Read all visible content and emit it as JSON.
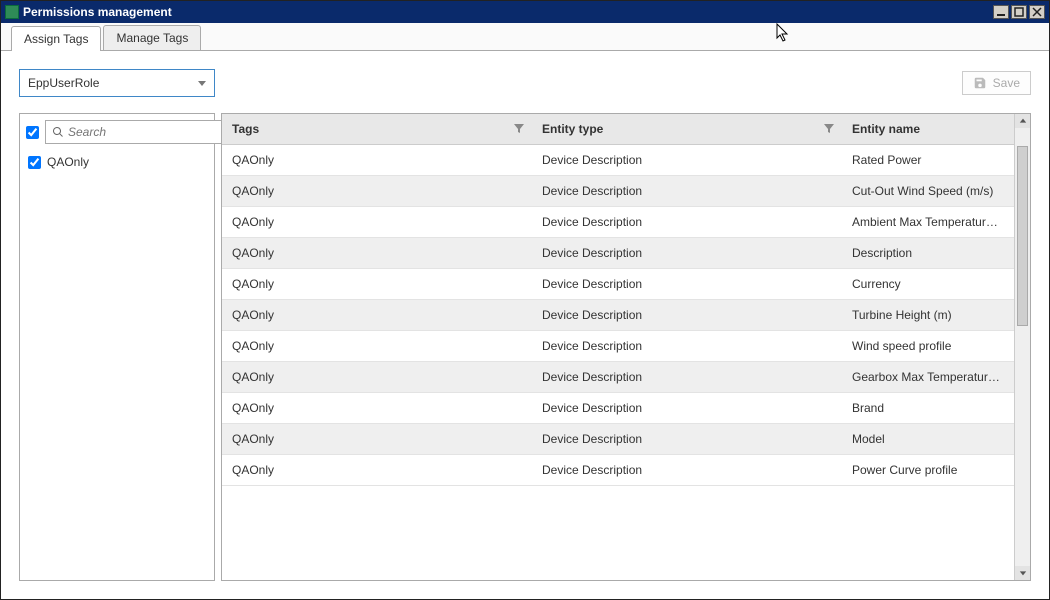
{
  "window": {
    "title": "Permissions management"
  },
  "tabs": [
    {
      "label": "Assign Tags",
      "active": true
    },
    {
      "label": "Manage Tags",
      "active": false
    }
  ],
  "role_select": {
    "value": "EppUserRole"
  },
  "save_button": {
    "label": "Save",
    "enabled": false
  },
  "tag_filter": {
    "placeholder": "Search",
    "select_all_checked": true,
    "tags": [
      {
        "label": "QAOnly",
        "checked": true
      }
    ]
  },
  "table": {
    "columns": [
      {
        "label": "Tags",
        "filterable": true
      },
      {
        "label": "Entity type",
        "filterable": true
      },
      {
        "label": "Entity name",
        "filterable": false
      }
    ],
    "rows": [
      {
        "tags": "QAOnly",
        "entity_type": "Device Description",
        "entity_name": "Rated Power"
      },
      {
        "tags": "QAOnly",
        "entity_type": "Device Description",
        "entity_name": "Cut-Out Wind Speed (m/s)"
      },
      {
        "tags": "QAOnly",
        "entity_type": "Device Description",
        "entity_name": "Ambient Max Temperature (ºC)"
      },
      {
        "tags": "QAOnly",
        "entity_type": "Device Description",
        "entity_name": "Description"
      },
      {
        "tags": "QAOnly",
        "entity_type": "Device Description",
        "entity_name": "Currency"
      },
      {
        "tags": "QAOnly",
        "entity_type": "Device Description",
        "entity_name": "Turbine Height (m)"
      },
      {
        "tags": "QAOnly",
        "entity_type": "Device Description",
        "entity_name": "Wind speed profile"
      },
      {
        "tags": "QAOnly",
        "entity_type": "Device Description",
        "entity_name": "Gearbox Max Temperature (ºC)"
      },
      {
        "tags": "QAOnly",
        "entity_type": "Device Description",
        "entity_name": "Brand"
      },
      {
        "tags": "QAOnly",
        "entity_type": "Device Description",
        "entity_name": "Model"
      },
      {
        "tags": "QAOnly",
        "entity_type": "Device Description",
        "entity_name": "Power Curve profile"
      }
    ]
  }
}
